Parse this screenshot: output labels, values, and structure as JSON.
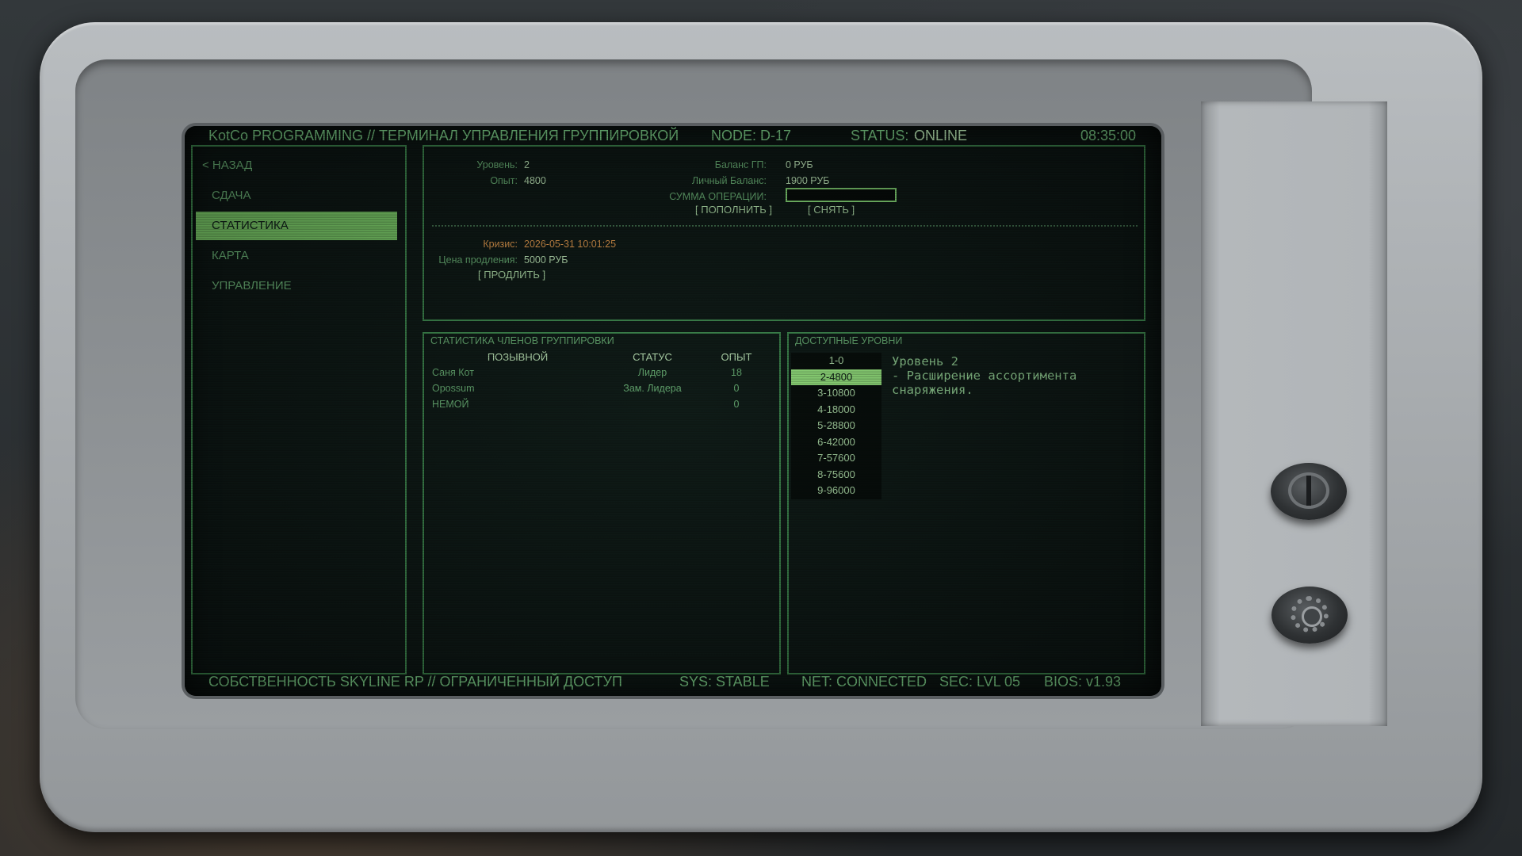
{
  "topbar": {
    "title": "KotCo PROGRAMMING // ТЕРМИНАЛ УПРАВЛЕНИЯ ГРУППИРОВКОЙ",
    "node": "NODE: D-17",
    "status_label": "STATUS:",
    "status_value": "ONLINE",
    "time": "08:35:00"
  },
  "nav": {
    "back": "< НАЗАД",
    "items": [
      "СДАЧА",
      "СТАТИСТИКА",
      "КАРТА",
      "УПРАВЛЕНИЕ"
    ],
    "active_index": 1
  },
  "info": {
    "level_label": "Уровень:",
    "level_value": "2",
    "exp_label": "Опыт:",
    "exp_value": "4800",
    "balance_gp_label": "Баланс ГП:",
    "balance_gp_value": "0 РУБ",
    "personal_balance_label": "Личный Баланс:",
    "personal_balance_value": "1900 РУБ",
    "amount_label": "СУММА ОПЕРАЦИИ:",
    "amount_value": "",
    "deposit_button": "[ ПОПОЛНИТЬ ]",
    "withdraw_button": "[ СНЯТЬ ]",
    "crisis_label": "Кризис:",
    "crisis_value": "2026-05-31 10:01:25",
    "extend_price_label": "Цена продления:",
    "extend_price_value": "5000 РУБ",
    "extend_button": "[ ПРОДЛИТЬ ]"
  },
  "members": {
    "title": "СТАТИСТИКА ЧЛЕНОВ ГРУППИРОВКИ",
    "columns": [
      "ПОЗЫВНОЙ",
      "СТАТУС",
      "ОПЫТ"
    ],
    "rows": [
      [
        "Саня Кот",
        "Лидер",
        "18"
      ],
      [
        "Opossum",
        "Зам. Лидера",
        "0"
      ],
      [
        "НЕМОЙ",
        "",
        "0"
      ]
    ]
  },
  "levels": {
    "title": "ДОСТУПНЫЕ УРОВНИ",
    "items": [
      "1-0",
      "2-4800",
      "3-10800",
      "4-18000",
      "5-28800",
      "6-42000",
      "7-57600",
      "8-75600",
      "9-96000"
    ],
    "selected_index": 1,
    "detail_title": "Уровень 2",
    "detail_line1": "- Расширение ассортимента",
    "detail_line2": "снаряжения."
  },
  "bottombar": {
    "ownership": "СОБСТВЕННОСТЬ SKYLINE RP // ОГРАНИЧЕННЫЙ ДОСТУП",
    "sys": "SYS: STABLE",
    "net": "NET: CONNECTED",
    "sec": "SEC: LVL 05",
    "bios": "BIOS: v1.93"
  },
  "colors": {
    "accent": "#7ecf6a",
    "text_green": "#7fd38a",
    "orange": "#f0a050",
    "screen_bg": "#0d1614"
  }
}
